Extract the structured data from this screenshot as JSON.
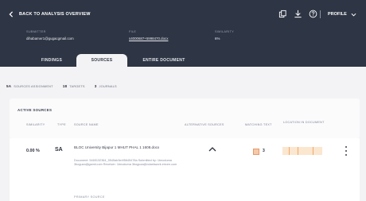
{
  "header": {
    "back_label": "BACK TO ANALYSIS OVERVIEW",
    "profile_label": "PROFILE",
    "icons": [
      "copy-icon",
      "download-icon",
      "help-icon"
    ]
  },
  "meta": {
    "submitter": {
      "label": "SUBMITTER",
      "value": "dihabamer1@gugacgmail.com"
    },
    "file": {
      "label": "FILE",
      "value": "s4000687+5998470.docx"
    },
    "similarity": {
      "label": "SIMILARITY",
      "value": "6%"
    }
  },
  "tabs": [
    {
      "label": "FINDINGS"
    },
    {
      "label": "SOURCES"
    },
    {
      "label": "ENTIRE DOCUMENT"
    }
  ],
  "summary": [
    {
      "count": "5A",
      "label": "SOURCES ASSIGNMENT"
    },
    {
      "count": "18",
      "label": "TARGETS"
    },
    {
      "count": "3",
      "label": "JOURNALS"
    }
  ],
  "active_sources": {
    "title": "ACTIVE SOURCES",
    "columns": [
      "SIMILARITY",
      "TYPE",
      "SOURCE NAME",
      "ALTERNATIVE SOURCES",
      "MATCHING TEXT",
      "LOCATION IN DOCUMENT"
    ],
    "row": {
      "similarity": "0.00 %",
      "type": "SA",
      "name": "BLOC University Bijapur 1 MHUT PHAL 1 1608.docx",
      "details": "Document: 5465132364_5545ab3e4f5645478a Submitted by: 1tmoduma 3boguza@gamii.com Receiver: 1tmoduma 3boguza@ndaekwork.ericen.com",
      "matching_count": "3",
      "primary_label": "PRIMARY SOURCE"
    }
  },
  "colors": {
    "header_bg": "#2e3544",
    "page_bg": "#f3f3f5",
    "match_accent": "#f0a96a"
  }
}
